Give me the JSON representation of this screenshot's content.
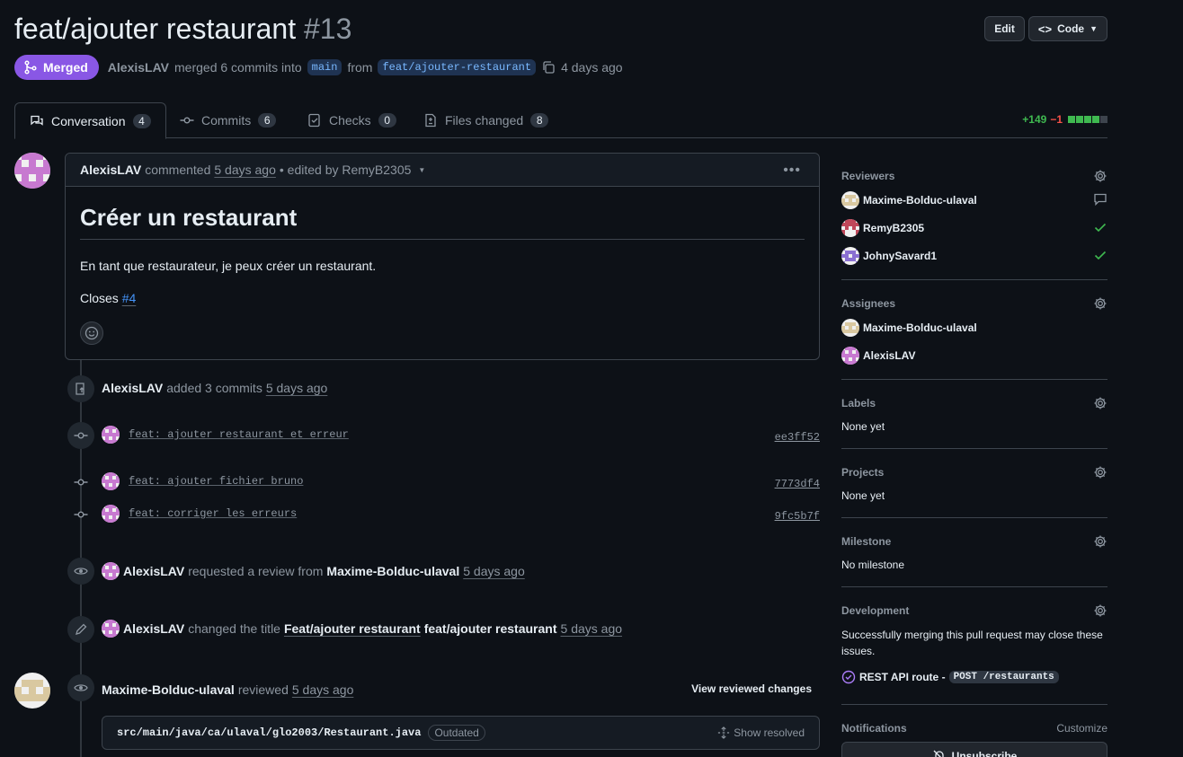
{
  "pr": {
    "title": "feat/ajouter restaurant",
    "number": "#13",
    "status": "Merged",
    "author": "AlexisLAV",
    "merged_text": "merged 6 commits into",
    "base_branch": "main",
    "from_text": "from",
    "head_branch": "feat/ajouter-restaurant",
    "time": "4 days ago"
  },
  "header_buttons": {
    "edit": "Edit",
    "code": "Code"
  },
  "tabs": [
    {
      "label": "Conversation",
      "count": "4",
      "icon": "comment-discussion-icon"
    },
    {
      "label": "Commits",
      "count": "6",
      "icon": "git-commit-icon"
    },
    {
      "label": "Checks",
      "count": "0",
      "icon": "checklist-icon"
    },
    {
      "label": "Files changed",
      "count": "8",
      "icon": "file-diff-icon"
    }
  ],
  "diffstat": {
    "additions": "+149",
    "deletions": "−1"
  },
  "comment": {
    "author": "AlexisLAV",
    "commented": "commented",
    "time": "5 days ago",
    "edited": "• edited by RemyB2305",
    "heading": "Créer un restaurant",
    "body": "En tant que restaurateur, je peux créer un restaurant.",
    "closes_label": "Closes",
    "closes_ref": "#4"
  },
  "timeline": {
    "added_commits": {
      "author": "AlexisLAV",
      "action": "added 3 commits",
      "time": "5 days ago"
    },
    "commits": [
      {
        "message": "feat: ajouter restaurant et erreur",
        "sha": "ee3ff52"
      },
      {
        "message": "feat: ajouter fichier bruno",
        "sha": "7773df4"
      },
      {
        "message": "feat: corriger les erreurs",
        "sha": "9fc5b7f"
      }
    ],
    "review_request": {
      "author": "AlexisLAV",
      "action": "requested a review from",
      "target": "Maxime-Bolduc-ulaval",
      "time": "5 days ago"
    },
    "title_change": {
      "author": "AlexisLAV",
      "action": "changed the title",
      "old": "Feat/ajouter restaurant",
      "new": "feat/ajouter restaurant",
      "time": "5 days ago"
    },
    "review": {
      "author": "Maxime-Bolduc-ulaval",
      "action": "reviewed",
      "time": "5 days ago",
      "view_changes": "View reviewed changes"
    },
    "file": {
      "path": "src/main/java/ca/ulaval/glo2003/Restaurant.java",
      "badge": "Outdated",
      "show_resolved": "Show resolved"
    }
  },
  "sidebar": {
    "reviewers_title": "Reviewers",
    "reviewers": [
      {
        "name": "Maxime-Bolduc-ulaval",
        "status": "comment-icon"
      },
      {
        "name": "RemyB2305",
        "status": "check-icon"
      },
      {
        "name": "JohnySavard1",
        "status": "check-icon"
      }
    ],
    "assignees_title": "Assignees",
    "assignees": [
      {
        "name": "Maxime-Bolduc-ulaval"
      },
      {
        "name": "AlexisLAV"
      }
    ],
    "labels_title": "Labels",
    "labels_value": "None yet",
    "projects_title": "Projects",
    "projects_value": "None yet",
    "milestone_title": "Milestone",
    "milestone_value": "No milestone",
    "development_title": "Development",
    "development_text": "Successfully merging this pull request may close these issues.",
    "linked_issue": "REST API route -",
    "linked_issue_code": "POST /restaurants",
    "notifications_title": "Notifications",
    "customize": "Customize",
    "unsubscribe": "Unsubscribe"
  },
  "colors": {
    "merged": "#8957e5",
    "link": "#4493f8",
    "success": "#3fb950",
    "danger": "#f85149"
  }
}
